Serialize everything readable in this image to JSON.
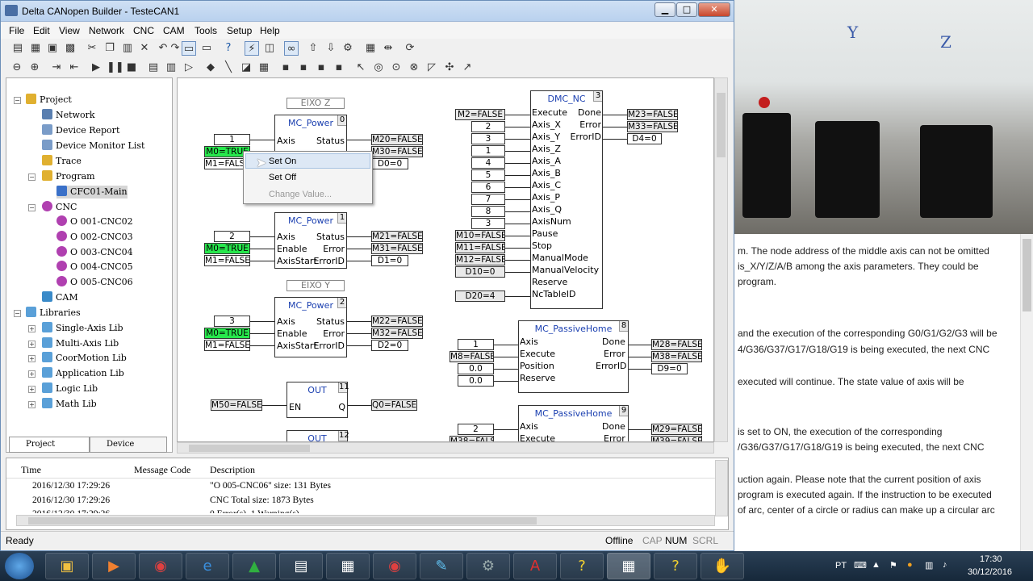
{
  "window": {
    "title": "Delta CANopen Builder - TesteCAN1",
    "minimize": "▁",
    "maximize": "□",
    "close": "✕"
  },
  "menu": [
    "File",
    "Edit",
    "View",
    "Network",
    "CNC",
    "CAM",
    "Tools",
    "Setup",
    "Help"
  ],
  "toolbar1_icons": [
    "new-icon",
    "open-icon",
    "save-icon",
    "saveall-icon",
    "cut-icon",
    "copy-icon",
    "paste-icon",
    "delete-icon",
    "undo-icon",
    "redo-icon",
    "view1-icon",
    "view2-icon",
    "help-icon",
    "online-icon",
    "offline-icon",
    "monitor-icon",
    "upload-icon",
    "download-icon",
    "settings-icon",
    "grid-icon",
    "split-icon",
    "refresh-icon"
  ],
  "toolbar2_icons": [
    "zoom-out-icon",
    "zoom-in-icon",
    "step-in-icon",
    "step-out-icon",
    "run-icon",
    "pause-icon",
    "stop-icon",
    "block1-icon",
    "block2-icon",
    "play-icon",
    "diamond-icon",
    "line-icon",
    "fb-icon",
    "table-icon",
    "pin1-icon",
    "pin2-icon",
    "pin3-icon",
    "pin4-icon",
    "cursor-icon",
    "target1-icon",
    "target2-icon",
    "target3-icon",
    "corner-icon",
    "tools-icon",
    "pointer-icon"
  ],
  "tree": {
    "project": "Project",
    "network": "Network",
    "device_report": "Device Report",
    "device_monitor": "Device Monitor List",
    "trace": "Trace",
    "program": "Program",
    "cfc": "CFC01-Main",
    "cnc": "CNC",
    "cnc_items": [
      "O 001-CNC02",
      "O 002-CNC03",
      "O 003-CNC04",
      "O 004-CNC05",
      "O 005-CNC06"
    ],
    "cam": "CAM",
    "libraries": "Libraries",
    "libs": [
      "Single-Axis Lib",
      "Multi-Axis Lib",
      "CoorMotion Lib",
      "Application Lib",
      "Logic Lib",
      "Math Lib"
    ],
    "tab_project": "Project",
    "tab_device": "Device"
  },
  "diagram": {
    "label_eixo_z": "EIXO Z",
    "label_eixo_y": "EIXO Y",
    "mc_power": [
      {
        "title": "MC_Power",
        "num": "0",
        "axis": "1",
        "enable": "M0=TRUE",
        "axisstart": "M1=FALSE",
        "status": "M20=FALSE",
        "error": "M30=FALSE",
        "errorid": "D0=0"
      },
      {
        "title": "MC_Power",
        "num": "1",
        "axis": "2",
        "enable": "M0=TRUE",
        "axisstart": "M1=FALSE",
        "status": "M21=FALSE",
        "error": "M31=FALSE",
        "errorid": "D1=0"
      },
      {
        "title": "MC_Power",
        "num": "2",
        "axis": "3",
        "enable": "M0=TRUE",
        "axisstart": "M1=FALSE",
        "status": "M22=FALSE",
        "error": "M32=FALSE",
        "errorid": "D2=0"
      }
    ],
    "pins_power_in": [
      "Axis",
      "Enable",
      "AxisStart"
    ],
    "pins_power_out": [
      "Status",
      "Error",
      "ErrorID"
    ],
    "out_blocks": [
      {
        "title": "OUT",
        "num": "11",
        "en": "EN",
        "q": "Q",
        "in": "M50=FALSE",
        "out": "Q0=FALSE"
      },
      {
        "title": "OUT",
        "num": "12"
      }
    ],
    "dmc": {
      "title": "DMC_NC",
      "num": "3",
      "pins_in": [
        "Execute",
        "Axis_X",
        "Axis_Y",
        "Axis_Z",
        "Axis_A",
        "Axis_B",
        "Axis_C",
        "Axis_P",
        "Axis_Q",
        "AxisNum",
        "Pause",
        "Stop",
        "ManualMode",
        "ManualVelocity",
        "Reserve",
        "NcTableID"
      ],
      "vals_in": [
        "M2=FALSE",
        "2",
        "3",
        "1",
        "4",
        "5",
        "6",
        "7",
        "8",
        "3",
        "M10=FALSE",
        "M11=FALSE",
        "M12=FALSE",
        "D10=0",
        "",
        "D20=4"
      ],
      "pins_out": [
        "Done",
        "Error",
        "ErrorID"
      ],
      "vals_out": [
        "M23=FALSE",
        "M33=FALSE",
        "D4=0"
      ]
    },
    "passive": [
      {
        "title": "MC_PassiveHome",
        "num": "8",
        "pins_in": [
          "Axis",
          "Execute",
          "Position",
          "Reserve"
        ],
        "vals_in": [
          "1",
          "M8=FALSE",
          "0.0",
          "0.0"
        ],
        "pins_out": [
          "Done",
          "Error",
          "ErrorID"
        ],
        "vals_out": [
          "M28=FALSE",
          "M38=FALSE",
          "D9=0"
        ]
      },
      {
        "title": "MC_PassiveHome",
        "num": "9",
        "pins_in": [
          "Axis",
          "Execute"
        ],
        "vals_in": [
          "2",
          "M38=FALSE"
        ],
        "pins_out": [
          "Done",
          "Error"
        ],
        "vals_out": [
          "M29=FALSE",
          "M39=FALSE"
        ]
      }
    ]
  },
  "context_menu": {
    "set_on": "Set On",
    "set_off": "Set Off",
    "change_value": "Change Value..."
  },
  "log": {
    "headers": [
      "Time",
      "Message Code",
      "Description"
    ],
    "rows": [
      {
        "time": "2016/12/30  17:29:26",
        "code": "",
        "desc": "\"O 005-CNC06\" size: 131 Bytes"
      },
      {
        "time": "2016/12/30  17:29:26",
        "code": "",
        "desc": "CNC Total size: 1873 Bytes"
      },
      {
        "time": "2016/12/30  17:29:26",
        "code": "",
        "desc": "0 Error(s), 1 Warning(s)"
      }
    ]
  },
  "status": {
    "ready": "Ready",
    "offline": "Offline",
    "cap": "CAP",
    "num": "NUM",
    "scrl": "SCRL"
  },
  "doc_lines": [
    "m. The node address of the middle axis can not be omitted",
    "is_X/Y/Z/A/B among the axis parameters. They could be",
    "program.",
    "and the execution of the corresponding G0/G1/G2/G3 will be",
    "4/G36/G37/G17/G18/G19 is being executed, the next CNC",
    "executed will continue. The state value of axis will be",
    "is set to ON, the execution of the corresponding",
    "/G36/G37/G17/G18/G19 is being executed, the next CNC",
    "uction again. Please note that the current position of axis",
    "program is executed again. If the instruction to be executed",
    "of arc, center of a circle or radius can make up a circular arc"
  ],
  "photo_labels": [
    "Y",
    "Z"
  ],
  "taskbar": {
    "lang": "PT",
    "time": "17:30",
    "date": "30/12/2016",
    "apps": [
      "explorer-icon",
      "media-icon",
      "chrome-icon",
      "ie-icon",
      "drive-icon",
      "doc-icon",
      "network-icon",
      "chrome2-icon",
      "paint-icon",
      "robot-icon",
      "pdf-icon",
      "help1-icon",
      "builder-icon",
      "help2-icon",
      "hand-icon"
    ]
  },
  "colors": {
    "accent": "#1a3fb0",
    "true_fill": "#27e74c",
    "titlebar": "#b9d1ee"
  }
}
